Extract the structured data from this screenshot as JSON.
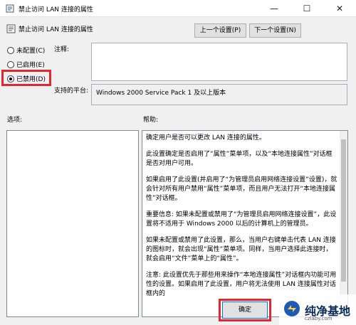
{
  "window": {
    "title": "禁止访问 LAN 连接的属性",
    "controls": {
      "minimize": "—",
      "maximize": "☐",
      "close": "✕"
    }
  },
  "header": {
    "policy_name": "禁止访问 LAN 连接的属性",
    "prev_button": "上一个设置(P)",
    "next_button": "下一个设置(N)"
  },
  "state_options": [
    {
      "label": "未配置(C)",
      "selected": false
    },
    {
      "label": "已启用(E)",
      "selected": false
    },
    {
      "label": "已禁用(D)",
      "selected": true
    }
  ],
  "comment": {
    "label": "注释:",
    "value": ""
  },
  "platform": {
    "label": "支持的平台:",
    "value": "Windows 2000 Service Pack 1 及以上版本"
  },
  "options": {
    "label": "选项:"
  },
  "help": {
    "label": "帮助:",
    "paragraphs": [
      "确定用户是否可以更改 LAN 连接的属性。",
      "此设置确定是否启用了“属性”菜单项，以及“本地连接属性”对话框是否对用户可用。",
      "如果启用了此设置(并启用了“为管理员启用网络连接设置”设置)，就会针对所有用户禁用“属性”菜单项，而且用户无法打开“本地连接属性”对话框。",
      "重要信息: 如果未配置或禁用了“为管理员启用网络连接设置”，此设置将不适用于 Windows 2000 以后的计算机上的管理员。",
      "如果未配置或禁用了此设置，那么，当用户右键单击代表 LAN 连接的图标时，就会出现“属性”菜单项。同样，当用户选择此连接时，就会启用“文件”菜单上的“属性”。",
      "注意: 此设置优先于那些用来操作“本地连接属性”对话框内功能可用性的设置。如果启用了此设置，用户将无法使用 LAN 连接属性对话框内的"
    ]
  },
  "footer": {
    "ok_button": "确定"
  },
  "watermark": {
    "text": "纯净基地",
    "url": "czlaby.com"
  },
  "colors": {
    "highlight": "#e0292f",
    "accent": "#0078d7",
    "watermark_text": "#0a2a5c"
  }
}
